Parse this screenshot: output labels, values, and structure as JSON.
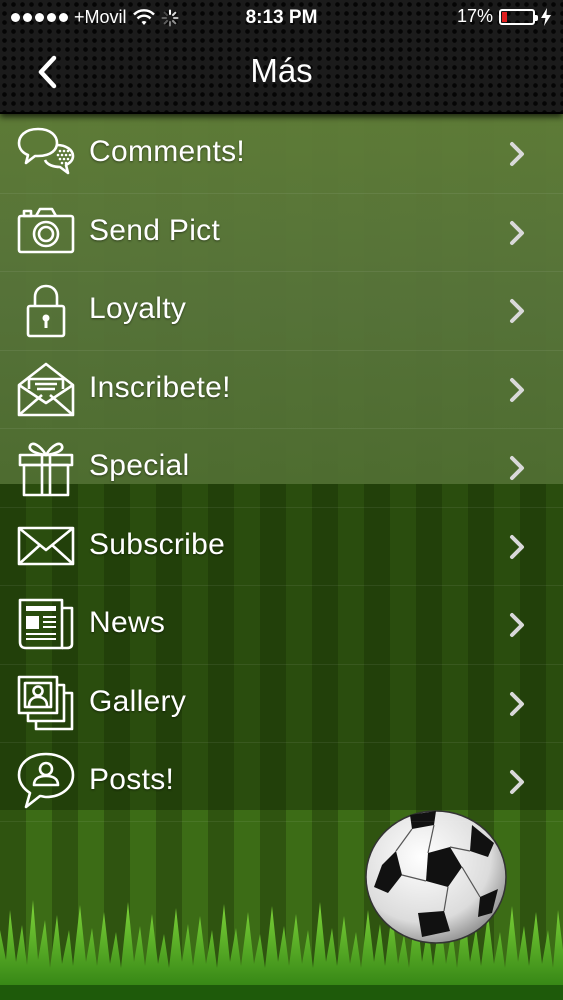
{
  "status_bar": {
    "carrier": "+Movil",
    "time": "8:13 PM",
    "battery_percent": "17%",
    "battery_level": 0.17,
    "battery_color": "#e02020"
  },
  "nav": {
    "title": "Más",
    "back_icon": "chevron-left-icon"
  },
  "menu": {
    "items": [
      {
        "label": "Comments!",
        "icon": "comments-icon"
      },
      {
        "label": "Send Pict",
        "icon": "camera-icon"
      },
      {
        "label": "Loyalty",
        "icon": "lock-icon"
      },
      {
        "label": "Inscribete!",
        "icon": "open-envelope-icon"
      },
      {
        "label": "Special",
        "icon": "gift-icon"
      },
      {
        "label": "Subscribe",
        "icon": "envelope-icon"
      },
      {
        "label": "News",
        "icon": "newspaper-icon"
      },
      {
        "label": "Gallery",
        "icon": "photo-gallery-icon"
      },
      {
        "label": "Posts!",
        "icon": "user-speech-icon"
      }
    ],
    "chevron_icon": "chevron-right-icon"
  },
  "theme": {
    "background": "soccer-field",
    "text_color": "#ffffff",
    "chevron_color": "#d9d9d9"
  }
}
